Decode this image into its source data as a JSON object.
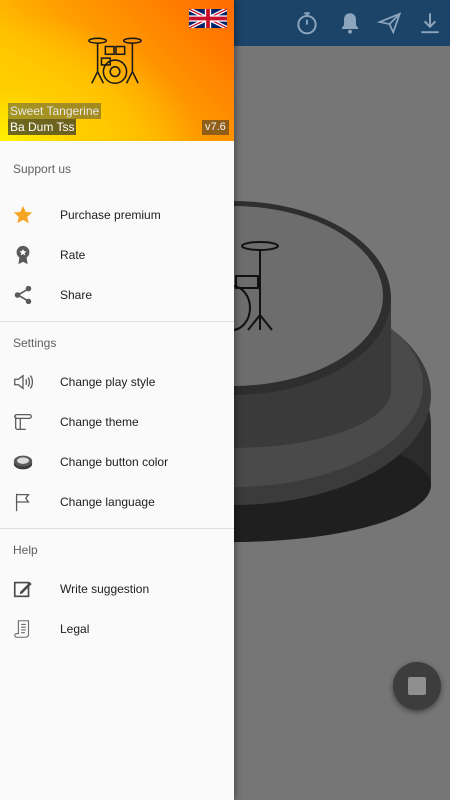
{
  "app": {
    "name": "Ba Dum Tss",
    "subtitle": "Sweet Tangerine",
    "version": "v7.6",
    "language_flag": "uk-flag-icon"
  },
  "toolbar": {
    "actions": [
      {
        "icon": "stopwatch-icon"
      },
      {
        "icon": "bell-icon"
      },
      {
        "icon": "send-icon"
      },
      {
        "icon": "download-icon"
      }
    ]
  },
  "drawer": {
    "sections": [
      {
        "title": "Support us",
        "items": [
          {
            "label": "Purchase premium",
            "icon": "star-icon"
          },
          {
            "label": "Rate",
            "icon": "award-icon"
          },
          {
            "label": "Share",
            "icon": "share-icon"
          }
        ]
      },
      {
        "title": "Settings",
        "items": [
          {
            "label": "Change play style",
            "icon": "speaker-icon"
          },
          {
            "label": "Change theme",
            "icon": "scroll-icon"
          },
          {
            "label": "Change button color",
            "icon": "button-color-icon"
          },
          {
            "label": "Change language",
            "icon": "flag-icon"
          }
        ]
      },
      {
        "title": "Help",
        "items": [
          {
            "label": "Write suggestion",
            "icon": "edit-icon"
          },
          {
            "label": "Legal",
            "icon": "document-icon"
          }
        ]
      }
    ]
  },
  "colors": {
    "appbar": "#1b4468",
    "star": "#f5a623",
    "scrim": "#767676"
  },
  "fab": {
    "icon": "stop-icon"
  }
}
